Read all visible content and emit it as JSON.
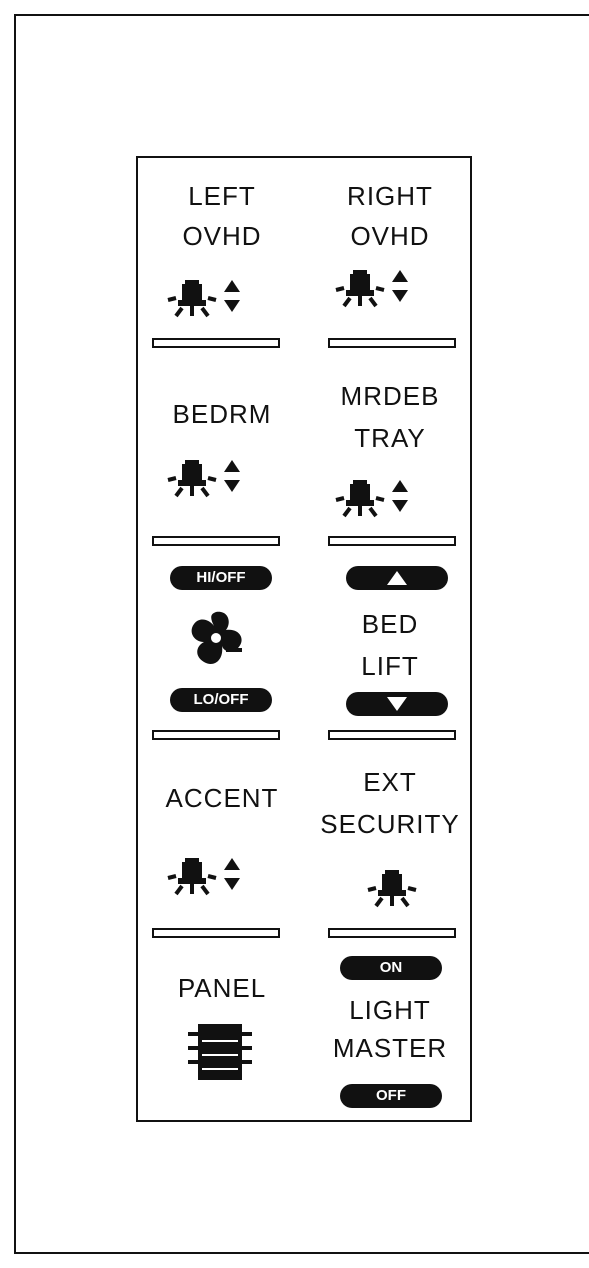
{
  "panel": {
    "left_ovhd": {
      "line1": "LEFT",
      "line2": "OVHD"
    },
    "right_ovhd": {
      "line1": "RIGHT",
      "line2": "OVHD"
    },
    "bedrm": {
      "line1": "BEDRM"
    },
    "mrdeb_tray": {
      "line1": "MRDEB",
      "line2": "TRAY"
    },
    "fan": {
      "hi_off": "HI/OFF",
      "lo_off": "LO/OFF"
    },
    "bed_lift": {
      "line1": "BED",
      "line2": "LIFT"
    },
    "accent": {
      "line1": "ACCENT"
    },
    "ext_security": {
      "line1": "EXT",
      "line2": "SECURITY"
    },
    "panel_light": {
      "line1": "PANEL"
    },
    "light_master": {
      "on": "ON",
      "line1": "LIGHT",
      "line2": "MASTER",
      "off": "OFF"
    }
  }
}
